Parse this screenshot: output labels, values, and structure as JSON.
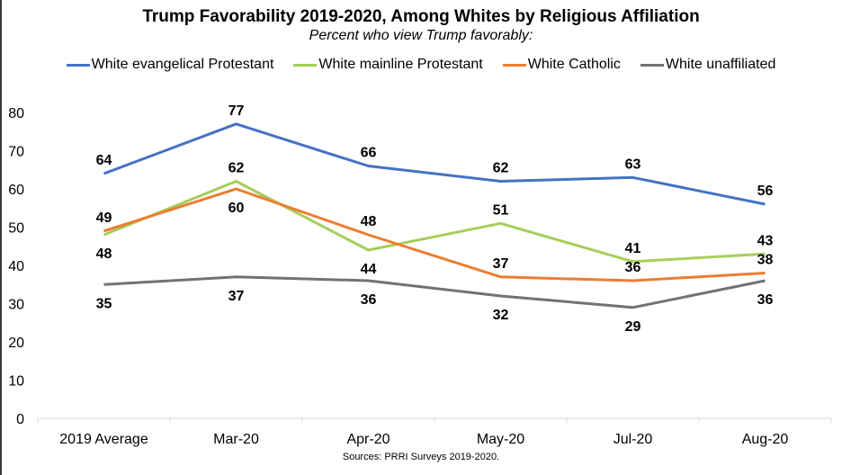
{
  "chart_data": {
    "type": "line",
    "title": "Trump Favorability 2019-2020, Among Whites by Religious Affiliation",
    "subtitle": "Percent who view Trump favorably:",
    "xlabel": "",
    "ylabel": "",
    "categories": [
      "2019 Average",
      "Mar-20",
      "Apr-20",
      "May-20",
      "Jul-20",
      "Aug-20"
    ],
    "ylim": [
      0,
      80
    ],
    "yticks": [
      0,
      10,
      20,
      30,
      40,
      50,
      60,
      70,
      80
    ],
    "grid": false,
    "legend_position": "top",
    "series": [
      {
        "name": "White evangelical Protestant",
        "color": "#4472C4",
        "values": [
          64,
          77,
          66,
          62,
          63,
          56
        ],
        "label_pos": [
          "above",
          "above",
          "above",
          "above",
          "above",
          "above"
        ]
      },
      {
        "name": "White mainline Protestant",
        "color": "#A5CE5A",
        "values": [
          48,
          62,
          44,
          51,
          41,
          43
        ],
        "label_pos": [
          "below",
          "above",
          "below",
          "above",
          "above",
          "above"
        ]
      },
      {
        "name": "White Catholic",
        "color": "#ED7D31",
        "values": [
          49,
          60,
          48,
          37,
          36,
          38
        ],
        "label_pos": [
          "above",
          "below",
          "above",
          "above",
          "above",
          "above"
        ]
      },
      {
        "name": "White unaffiliated",
        "color": "#767171",
        "values": [
          35,
          37,
          36,
          32,
          29,
          36
        ],
        "label_pos": [
          "below",
          "below",
          "below",
          "below",
          "below",
          "below"
        ]
      }
    ],
    "source": "Sources: PRRI Surveys 2019-2020."
  }
}
